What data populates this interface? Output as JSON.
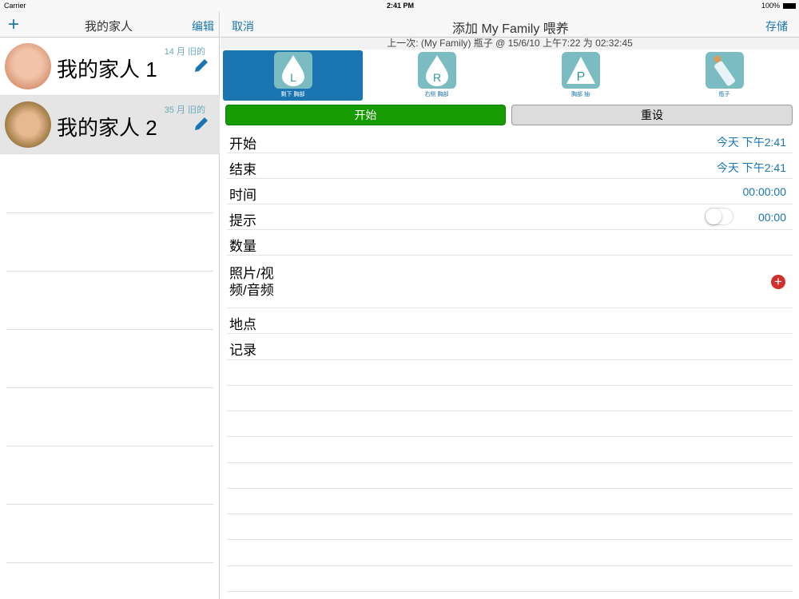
{
  "status_bar": {
    "carrier": "Carrier",
    "time": "2:41 PM",
    "battery": "100%"
  },
  "left_nav": {
    "title": "我的家人",
    "add": "+",
    "edit": "编辑"
  },
  "family": [
    {
      "name": "我的家人 1",
      "age": "14 月 旧的",
      "selected": false
    },
    {
      "name": "我的家人 2",
      "age": "35 月 旧的",
      "selected": true
    }
  ],
  "right_nav": {
    "cancel": "取消",
    "title": "添加 My Family 喂养",
    "save": "存储"
  },
  "last_feed": "上一次: (My Family) 瓶子 @ 15/6/10 上午7:22 为 02:32:45",
  "feed_types": [
    {
      "label": "剩下 胸部",
      "letter": "L",
      "selected": true
    },
    {
      "label": "右侧 胸部",
      "letter": "R",
      "selected": false
    },
    {
      "label": "胸部 抽",
      "letter": "P",
      "selected": false
    },
    {
      "label": "瓶子",
      "letter": "",
      "selected": false
    }
  ],
  "buttons": {
    "start": "开始",
    "reset": "重设"
  },
  "form": {
    "start_label": "开始",
    "start_value": "今天 下午2:41",
    "end_label": "结束",
    "end_value": "今天 下午2:41",
    "duration_label": "时间",
    "duration_value": "00:00:00",
    "reminder_label": "提示",
    "reminder_value": "00:00",
    "reminder_on": false,
    "amount_label": "数量",
    "media_label1": "照片/视",
    "media_label2": "频/音频",
    "location_label": "地点",
    "notes_label": "记录"
  },
  "colors": {
    "accent": "#1a75b0",
    "start": "#169b00",
    "add_media": "#d0312d"
  }
}
